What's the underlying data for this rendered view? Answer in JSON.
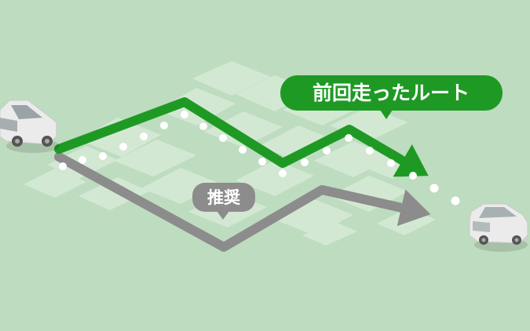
{
  "colors": {
    "background": "#bedcc0",
    "block": "#d6ead6",
    "previous_route": "#1e9a24",
    "recommended_route": "#8c8c8c",
    "dot": "#ffffff",
    "car_body": "#ebebeb"
  },
  "labels": {
    "previous_route": "前回走ったルート",
    "recommended": "推奨"
  },
  "icons": [
    "start-car-icon",
    "destination-car-icon",
    "route-arrow-icon"
  ]
}
